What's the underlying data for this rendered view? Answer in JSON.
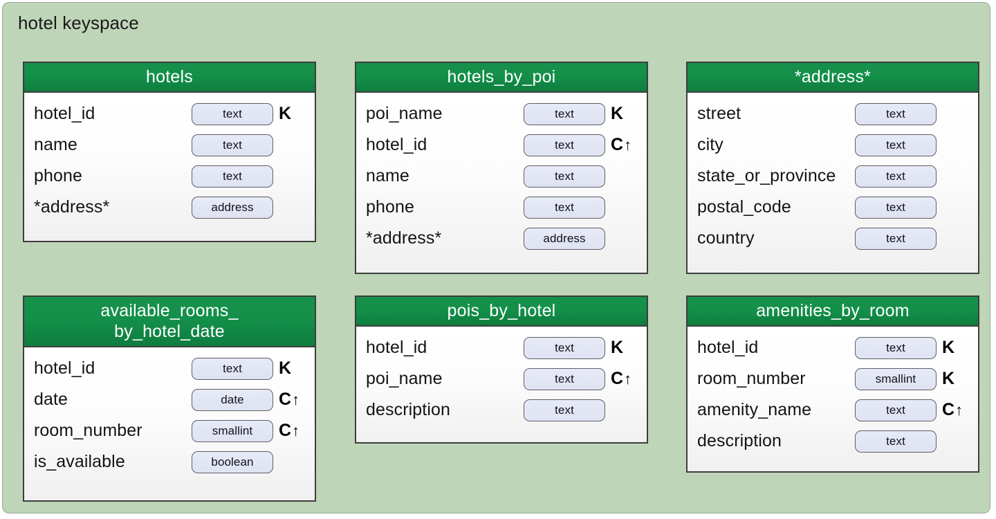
{
  "keyspace": {
    "title": "hotel keyspace",
    "background_color": "#bfd5b8",
    "border_color": "#9aa89a"
  },
  "legend": {
    "partition_key_marker": "K",
    "clustering_key_marker": "C",
    "clustering_ascending_marker": "↑",
    "header_color": "#139049",
    "pill_color": "#e2e6f4"
  },
  "tables": [
    {
      "id": "hotels",
      "name": "hotels",
      "name_lines": "hotels",
      "fields": [
        {
          "name": "hotel_id",
          "type": "text",
          "marker": "K",
          "arrow": ""
        },
        {
          "name": "name",
          "type": "text",
          "marker": "",
          "arrow": ""
        },
        {
          "name": "phone",
          "type": "text",
          "marker": "",
          "arrow": ""
        },
        {
          "name": "*address*",
          "type": "address",
          "marker": "",
          "arrow": ""
        }
      ]
    },
    {
      "id": "hotels_by_poi",
      "name": "hotels_by_poi",
      "name_lines": "hotels_by_poi",
      "fields": [
        {
          "name": "poi_name",
          "type": "text",
          "marker": "K",
          "arrow": ""
        },
        {
          "name": "hotel_id",
          "type": "text",
          "marker": "C",
          "arrow": "↑"
        },
        {
          "name": "name",
          "type": "text",
          "marker": "",
          "arrow": ""
        },
        {
          "name": "phone",
          "type": "text",
          "marker": "",
          "arrow": ""
        },
        {
          "name": "*address*",
          "type": "address",
          "marker": "",
          "arrow": ""
        }
      ]
    },
    {
      "id": "address",
      "name": "*address*",
      "name_lines": "*address*",
      "fields": [
        {
          "name": "street",
          "type": "text",
          "marker": "",
          "arrow": ""
        },
        {
          "name": "city",
          "type": "text",
          "marker": "",
          "arrow": ""
        },
        {
          "name": "state_or_province",
          "type": "text",
          "marker": "",
          "arrow": ""
        },
        {
          "name": "postal_code",
          "type": "text",
          "marker": "",
          "arrow": ""
        },
        {
          "name": "country",
          "type": "text",
          "marker": "",
          "arrow": ""
        }
      ]
    },
    {
      "id": "available_rooms_by_hotel_date",
      "name": "available_rooms_by_hotel_date",
      "name_lines": "available_rooms_\nby_hotel_date",
      "fields": [
        {
          "name": "hotel_id",
          "type": "text",
          "marker": "K",
          "arrow": ""
        },
        {
          "name": "date",
          "type": "date",
          "marker": "C",
          "arrow": "↑"
        },
        {
          "name": "room_number",
          "type": "smallint",
          "marker": "C",
          "arrow": "↑"
        },
        {
          "name": "is_available",
          "type": "boolean",
          "marker": "",
          "arrow": ""
        }
      ]
    },
    {
      "id": "pois_by_hotel",
      "name": "pois_by_hotel",
      "name_lines": "pois_by_hotel",
      "fields": [
        {
          "name": "hotel_id",
          "type": "text",
          "marker": "K",
          "arrow": ""
        },
        {
          "name": "poi_name",
          "type": "text",
          "marker": "C",
          "arrow": "↑"
        },
        {
          "name": "description",
          "type": "text",
          "marker": "",
          "arrow": ""
        }
      ]
    },
    {
      "id": "amenities_by_room",
      "name": "amenities_by_room",
      "name_lines": "amenities_by_room",
      "fields": [
        {
          "name": "hotel_id",
          "type": "text",
          "marker": "K",
          "arrow": ""
        },
        {
          "name": "room_number",
          "type": "smallint",
          "marker": "K",
          "arrow": ""
        },
        {
          "name": "amenity_name",
          "type": "text",
          "marker": "C",
          "arrow": "↑"
        },
        {
          "name": "description",
          "type": "text",
          "marker": "",
          "arrow": ""
        }
      ]
    }
  ]
}
